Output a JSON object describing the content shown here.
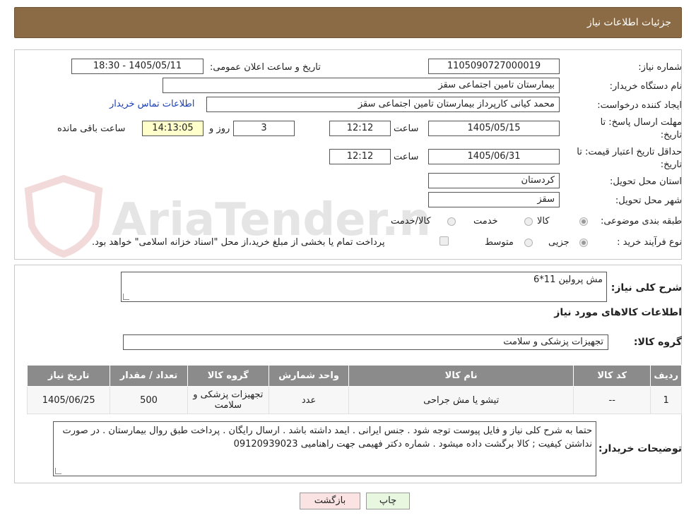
{
  "header": {
    "title": "جزئیات اطلاعات نیاز"
  },
  "watermark": {
    "text": "AriaTender.neT"
  },
  "fields": {
    "need_number_label": "شماره نیاز:",
    "need_number": "1105090727000019",
    "announce_label": "تاریخ و ساعت اعلان عمومی:",
    "announce_value": "1405/05/11 - 18:30",
    "buyer_org_label": "نام دستگاه خریدار:",
    "buyer_org": "بیمارستان تامین اجتماعی سقز",
    "creator_label": "ایجاد کننده درخواست:",
    "creator": "محمد کیانی کارپرداز بیمارستان تامین اجتماعی سقز",
    "contact_link": "اطلاعات تماس خریدار",
    "deadline_label_1": "مهلت ارسال پاسخ: تا",
    "deadline_label_2": "تاریخ:",
    "deadline_date": "1405/05/15",
    "time_label": "ساعت",
    "deadline_time": "12:12",
    "days_value": "3",
    "days_label": "روز و",
    "remaining_time": "14:13:05",
    "remaining_label": "ساعت باقی مانده",
    "validity_label_1": "حداقل تاریخ اعتبار قیمت: تا",
    "validity_label_2": "تاریخ:",
    "validity_date": "1405/06/31",
    "validity_time": "12:12",
    "province_label": "استان محل تحویل:",
    "province": "کردستان",
    "city_label": "شهر محل تحویل:",
    "city": "سقز",
    "category_label": "طبقه بندی موضوعی:",
    "category_options": [
      "کالا",
      "خدمت",
      "کالا/خدمت"
    ],
    "category_selected": "کالا",
    "process_label": "نوع فرآیند خرید :",
    "process_options": [
      "جزیی",
      "متوسط"
    ],
    "process_selected": "جزیی",
    "payment_note": "پرداخت تمام یا بخشی از مبلغ خرید،از محل \"اسناد خزانه اسلامی\" خواهد بود."
  },
  "summary": {
    "description_label": "شرح کلی نیاز:",
    "description": "مش پرولین 11*6",
    "goods_info_title": "اطلاعات کالاهای مورد نیاز",
    "goods_group_label": "گروه کالا:",
    "goods_group": "تجهیزات پزشکی و سلامت"
  },
  "table": {
    "headers": [
      "ردیف",
      "کد کالا",
      "نام کالا",
      "واحد شمارش",
      "گروه کالا",
      "تعداد / مقدار",
      "تاریخ نیاز"
    ],
    "rows": [
      [
        "1",
        "--",
        "تیشو یا مش جراحی",
        "عدد",
        "تجهیزات پزشکی و سلامت",
        "500",
        "1405/06/25"
      ]
    ]
  },
  "notes": {
    "label": "توضیحات خریدار:",
    "text": "حتما به شرح کلی نیاز  و فایل پیوست توجه شود .  جنس ایرانی .  ایمد داشته باشد . ارسال رایگان . پرداخت طبق روال بیمارستان . در صورت نداشتن کیفیت ; کالا برگشت داده میشود . شماره دکتر فهیمی جهت راهنامیی 09120939023"
  },
  "buttons": {
    "print": "چاپ",
    "back": "بازگشت"
  },
  "colors": {
    "header": "#8b6b45",
    "table_header": "#8b8b8b",
    "back_button": "#fbe3e3",
    "print_button": "#e8f8e0"
  }
}
